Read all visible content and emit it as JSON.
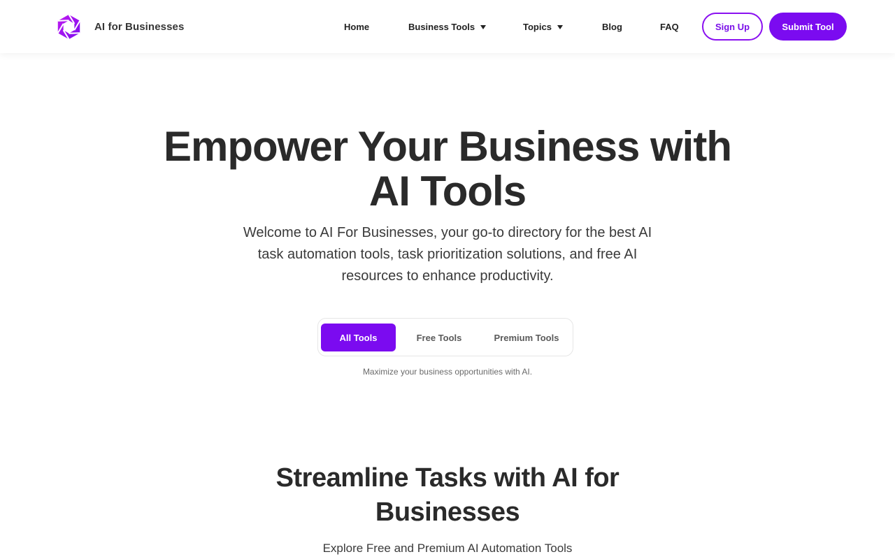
{
  "brand": {
    "name": "AI for Businesses",
    "accent_color": "#7b0bf0",
    "logo_icon": "hexagon-aperture-logo"
  },
  "nav": {
    "items": [
      {
        "label": "Home",
        "has_dropdown": false
      },
      {
        "label": "Business Tools",
        "has_dropdown": true
      },
      {
        "label": "Topics",
        "has_dropdown": true
      },
      {
        "label": "Blog",
        "has_dropdown": false
      },
      {
        "label": "FAQ",
        "has_dropdown": false
      }
    ],
    "signup_label": "Sign Up",
    "submit_label": "Submit Tool"
  },
  "hero": {
    "title_line1": "Empower Your Business with",
    "title_line2": "AI Tools",
    "subtitle": "Welcome to AI For Businesses, your go-to directory for the best AI task automation tools, task prioritization solutions, and free AI resources to enhance productivity.",
    "tabs": [
      {
        "label": "All Tools",
        "active": true
      },
      {
        "label": "Free Tools",
        "active": false
      },
      {
        "label": "Premium Tools",
        "active": false
      }
    ],
    "tagline": "Maximize your business opportunities with AI."
  },
  "section": {
    "title_line1": "Streamline Tasks with AI for",
    "title_line2": "Businesses",
    "subtitle": "Explore Free and Premium AI Automation Tools"
  }
}
